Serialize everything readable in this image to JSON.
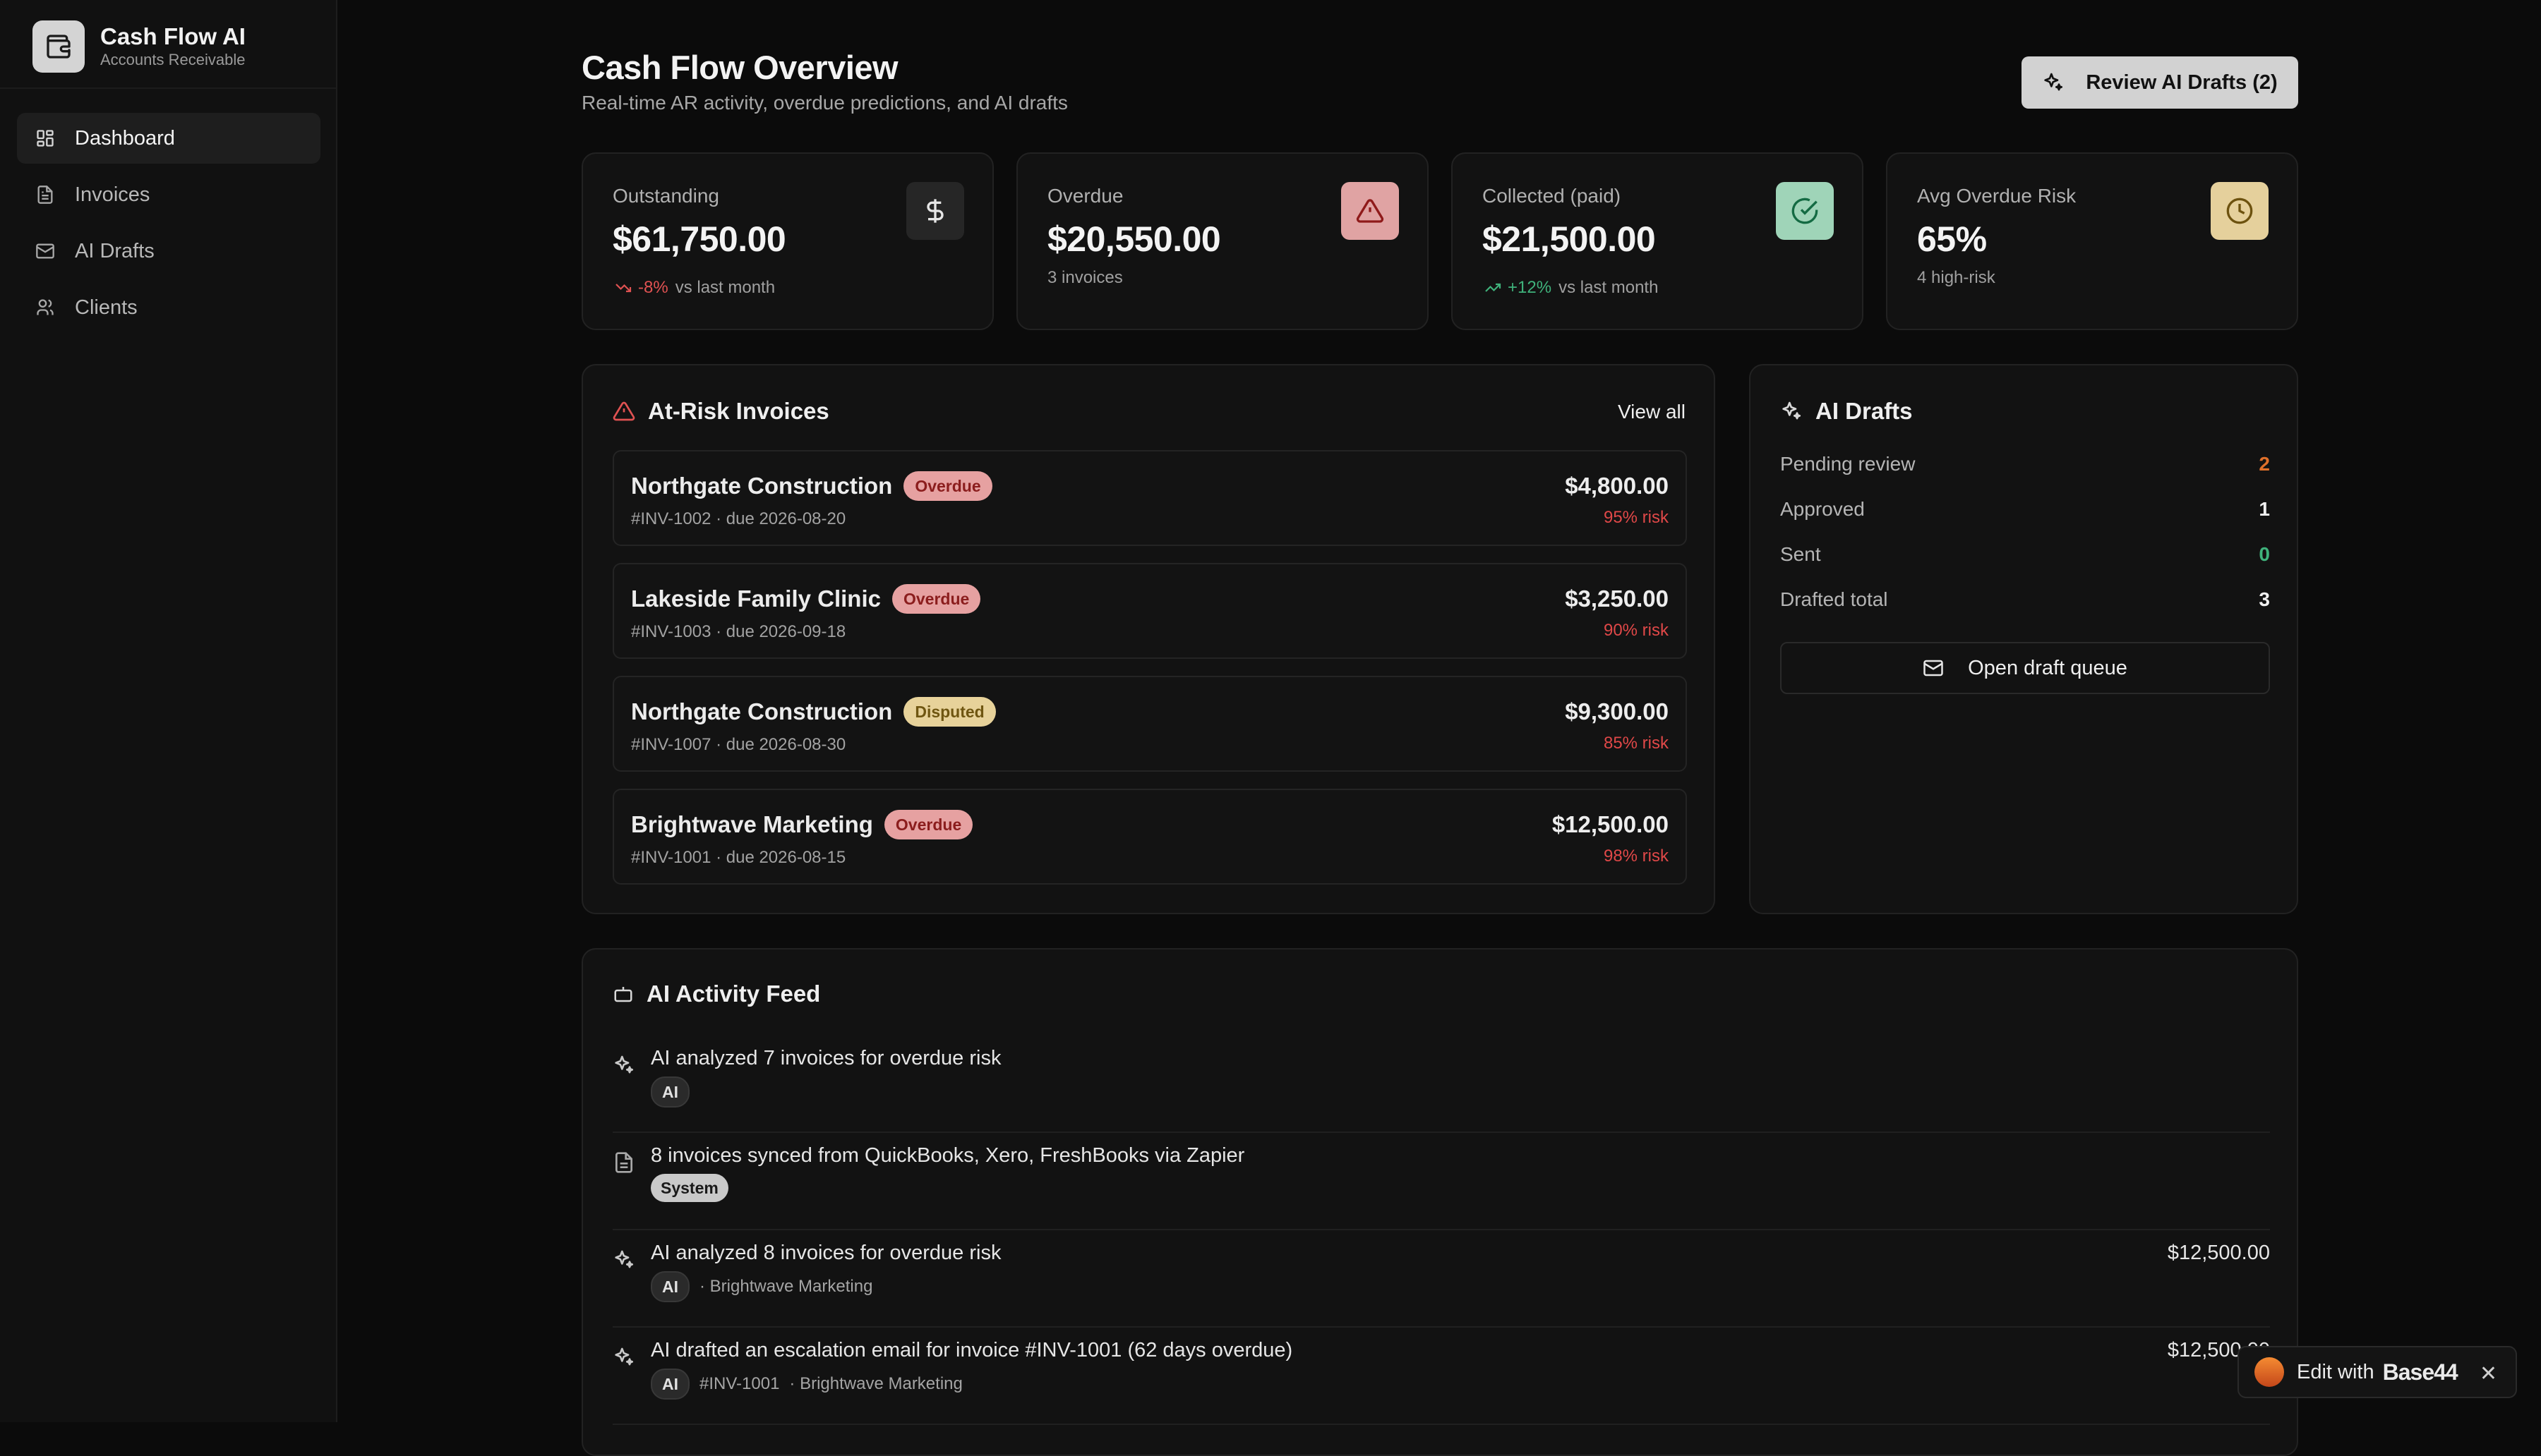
{
  "app": {
    "title": "Cash Flow AI",
    "subtitle": "Accounts Receivable"
  },
  "sidebar": {
    "items": [
      {
        "label": "Dashboard",
        "icon": "grid-icon",
        "active": true
      },
      {
        "label": "Invoices",
        "icon": "file-icon",
        "active": false
      },
      {
        "label": "AI Drafts",
        "icon": "mail-icon",
        "active": false
      },
      {
        "label": "Clients",
        "icon": "users-icon",
        "active": false
      }
    ]
  },
  "header": {
    "title": "Cash Flow Overview",
    "subtitle": "Real-time AR activity, overdue predictions, and AI drafts",
    "review_button": "Review AI Drafts (2)"
  },
  "stats": {
    "outstanding": {
      "label": "Outstanding",
      "value": "$61,750.00",
      "change": "-8%",
      "change_suffix": "vs last month",
      "icon": "dollar-icon"
    },
    "overdue": {
      "label": "Overdue",
      "value": "$20,550.00",
      "note": "3 invoices",
      "icon": "alert-triangle-icon"
    },
    "collected": {
      "label": "Collected (paid)",
      "value": "$21,500.00",
      "change": "+12%",
      "change_suffix": "vs last month",
      "icon": "check-circle-icon"
    },
    "risk": {
      "label": "Avg Overdue Risk",
      "value": "65%",
      "note": "4 high-risk",
      "icon": "clock-icon"
    }
  },
  "at_risk": {
    "title": "At-Risk Invoices",
    "view_all": "View all",
    "invoices": [
      {
        "client": "Northgate Construction",
        "status": "Overdue",
        "meta": "#INV-1002 · due 2026-08-20",
        "amount": "$4,800.00",
        "risk": "95% risk"
      },
      {
        "client": "Lakeside Family Clinic",
        "status": "Overdue",
        "meta": "#INV-1003 · due 2026-09-18",
        "amount": "$3,250.00",
        "risk": "90% risk"
      },
      {
        "client": "Northgate Construction",
        "status": "Disputed",
        "meta": "#INV-1007 · due 2026-08-30",
        "amount": "$9,300.00",
        "risk": "85% risk"
      },
      {
        "client": "Brightwave Marketing",
        "status": "Overdue",
        "meta": "#INV-1001 · due 2026-08-15",
        "amount": "$12,500.00",
        "risk": "98% risk"
      }
    ]
  },
  "drafts": {
    "title": "AI Drafts",
    "rows": [
      {
        "label": "Pending review",
        "value": "2",
        "color": "#e0702a"
      },
      {
        "label": "Approved",
        "value": "1",
        "color": "#f0f0f0"
      },
      {
        "label": "Sent",
        "value": "0",
        "color": "#3fb27b"
      },
      {
        "label": "Drafted total",
        "value": "3",
        "color": "#f0f0f0"
      }
    ],
    "open_button": "Open draft queue"
  },
  "feed": {
    "title": "AI Activity Feed",
    "items": [
      {
        "text": "AI analyzed 7 invoices for overdue risk",
        "tag": "AI",
        "invoice": "",
        "client": "",
        "amount": ""
      },
      {
        "text": "8 invoices synced from QuickBooks, Xero, FreshBooks via Zapier",
        "tag": "System",
        "invoice": "",
        "client": "",
        "amount": ""
      },
      {
        "text": "AI analyzed 8 invoices for overdue risk",
        "tag": "AI",
        "invoice": "",
        "client": "· Brightwave Marketing",
        "amount": "$12,500.00"
      },
      {
        "text": "AI drafted an escalation email for invoice #INV-1001 (62 days overdue)",
        "tag": "AI",
        "invoice": "#INV-1001",
        "client": "· Brightwave Marketing",
        "amount": "$12,500.00"
      }
    ]
  },
  "edit_chip": {
    "prefix": "Edit with",
    "brand": "Base44",
    "close": "✕"
  },
  "colors": {
    "accent_red": "#e05252",
    "accent_green": "#3fb27b",
    "accent_orange": "#e0702a"
  }
}
